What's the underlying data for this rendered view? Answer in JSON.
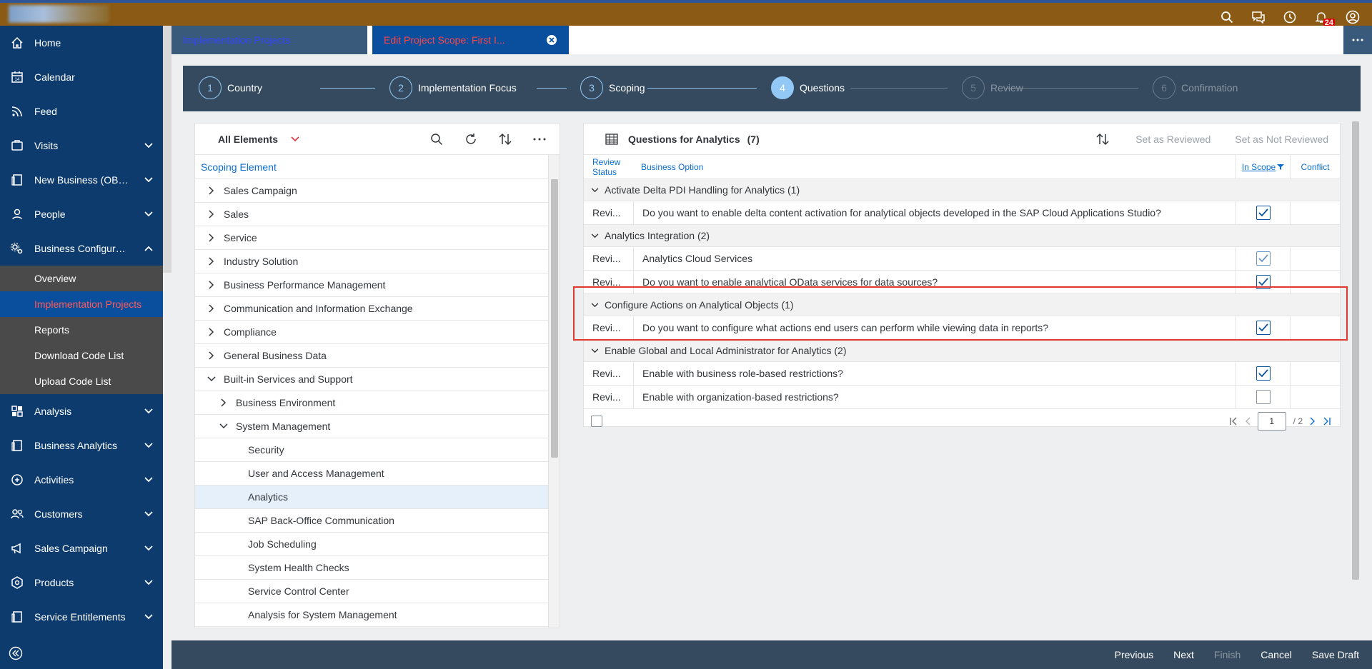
{
  "shell": {
    "notification_count": "24",
    "brand_color": "#8b5a14"
  },
  "sidebar": {
    "items": [
      {
        "label": "Home",
        "icon": "home-icon"
      },
      {
        "label": "Calendar",
        "icon": "calendar-icon"
      },
      {
        "label": "Feed",
        "icon": "feed-icon"
      },
      {
        "label": "Visits",
        "icon": "visits-icon"
      },
      {
        "label": "New Business (OBSOLETE)",
        "icon": "document-icon"
      },
      {
        "label": "People",
        "icon": "person-icon"
      },
      {
        "label": "Business Configuration",
        "icon": "gears-icon"
      }
    ],
    "sub_items": [
      "Overview",
      "Implementation Projects",
      "Reports",
      "Download Code List",
      "Upload Code List"
    ],
    "items_after": [
      {
        "label": "Analysis",
        "icon": "analysis-icon"
      },
      {
        "label": "Business Analytics",
        "icon": "document-icon"
      },
      {
        "label": "Activities",
        "icon": "activities-icon"
      },
      {
        "label": "Customers",
        "icon": "customers-icon"
      },
      {
        "label": "Sales Campaign",
        "icon": "megaphone-icon"
      },
      {
        "label": "Products",
        "icon": "products-icon"
      },
      {
        "label": "Service Entitlements",
        "icon": "document-icon"
      }
    ]
  },
  "tabs": {
    "tab1": "Implementation Projects",
    "tab2": "Edit Project Scope: First I..."
  },
  "wizard": {
    "steps": [
      {
        "num": "1",
        "label": "Country"
      },
      {
        "num": "2",
        "label": "Implementation Focus"
      },
      {
        "num": "3",
        "label": "Scoping"
      },
      {
        "num": "4",
        "label": "Questions"
      },
      {
        "num": "5",
        "label": "Review"
      },
      {
        "num": "6",
        "label": "Confirmation"
      }
    ]
  },
  "left_panel": {
    "filter": "All Elements",
    "header": "Scoping Element",
    "rows": [
      "Sales Campaign",
      "Sales",
      "Service",
      "Industry Solution",
      "Business Performance Management",
      "Communication and Information Exchange",
      "Compliance",
      "General Business Data",
      "Built-in Services and Support",
      "Business Environment",
      "System Management",
      "Security",
      "User and Access Management",
      "Analytics",
      "SAP Back-Office Communication",
      "Job Scheduling",
      "System Health Checks",
      "Service Control Center",
      "Analysis for System Management"
    ]
  },
  "right_panel": {
    "title": "Questions for Analytics",
    "count": "(7)",
    "set_reviewed": "Set as Reviewed",
    "set_not_reviewed": "Set as Not Reviewed",
    "col_status": "Review Status",
    "col_option": "Business Option",
    "col_scope": "In Scope",
    "col_conflict": "Conflict",
    "groups": [
      {
        "title": "Activate Delta PDI Handling for Analytics (1)",
        "rows": [
          {
            "status": "Revi...",
            "text": "Do you want to enable delta content activation for analytical objects developed in the SAP Cloud Applications Studio?",
            "in_scope": true
          }
        ]
      },
      {
        "title": "Analytics Integration (2)",
        "rows": [
          {
            "status": "Revi...",
            "text": "Analytics Cloud Services",
            "in_scope": true
          },
          {
            "status": "Revi...",
            "text": "Do you want to enable analytical OData services for data sources?",
            "in_scope": true
          }
        ]
      },
      {
        "title": "Configure Actions on Analytical Objects (1)",
        "rows": [
          {
            "status": "Revi...",
            "text": "Do you want to configure what actions end users can perform while viewing data in reports?",
            "in_scope": true
          }
        ]
      },
      {
        "title": "Enable Global and Local Administrator for Analytics (2)",
        "rows": [
          {
            "status": "Revi...",
            "text": "Enable with business role-based restrictions?",
            "in_scope": true
          },
          {
            "status": "Revi...",
            "text": "Enable with organization-based restrictions?",
            "in_scope": false
          }
        ]
      }
    ],
    "page_value": "1",
    "page_total": "/ 2"
  },
  "footer": {
    "previous": "Previous",
    "next": "Next",
    "finish": "Finish",
    "cancel": "Cancel",
    "save_draft": "Save Draft"
  }
}
